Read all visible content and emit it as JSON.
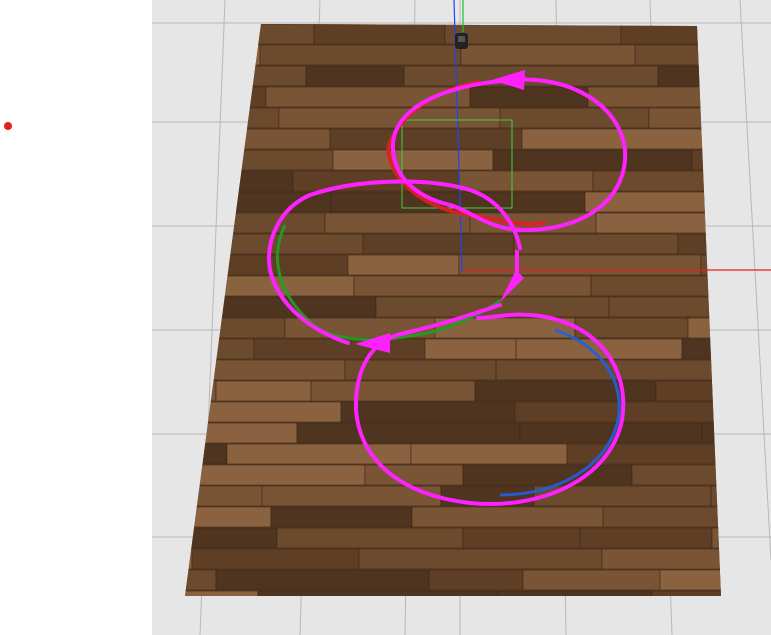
{
  "scene": {
    "background_color": "#ffffff",
    "ground_color": "#e6e6e6",
    "grid_line_color": "#b8b8b8",
    "floor_texture": "wood-planks",
    "floor_colors": [
      "#6b4a2e",
      "#7a5535",
      "#5e3f26",
      "#8a6240",
      "#4f341f"
    ]
  },
  "axes": {
    "x_color": "#e02020",
    "y_color": "#20c020",
    "z_color": "#2040ff"
  },
  "overlays": {
    "marker_dot_color": "#e02020",
    "path_annotation_color": "#ff22ff",
    "trajectory_colors": [
      "#e02020",
      "#20a020",
      "#2060e0"
    ],
    "bounding_box_color": "#40d040",
    "robot_icon": "robot-icon"
  }
}
